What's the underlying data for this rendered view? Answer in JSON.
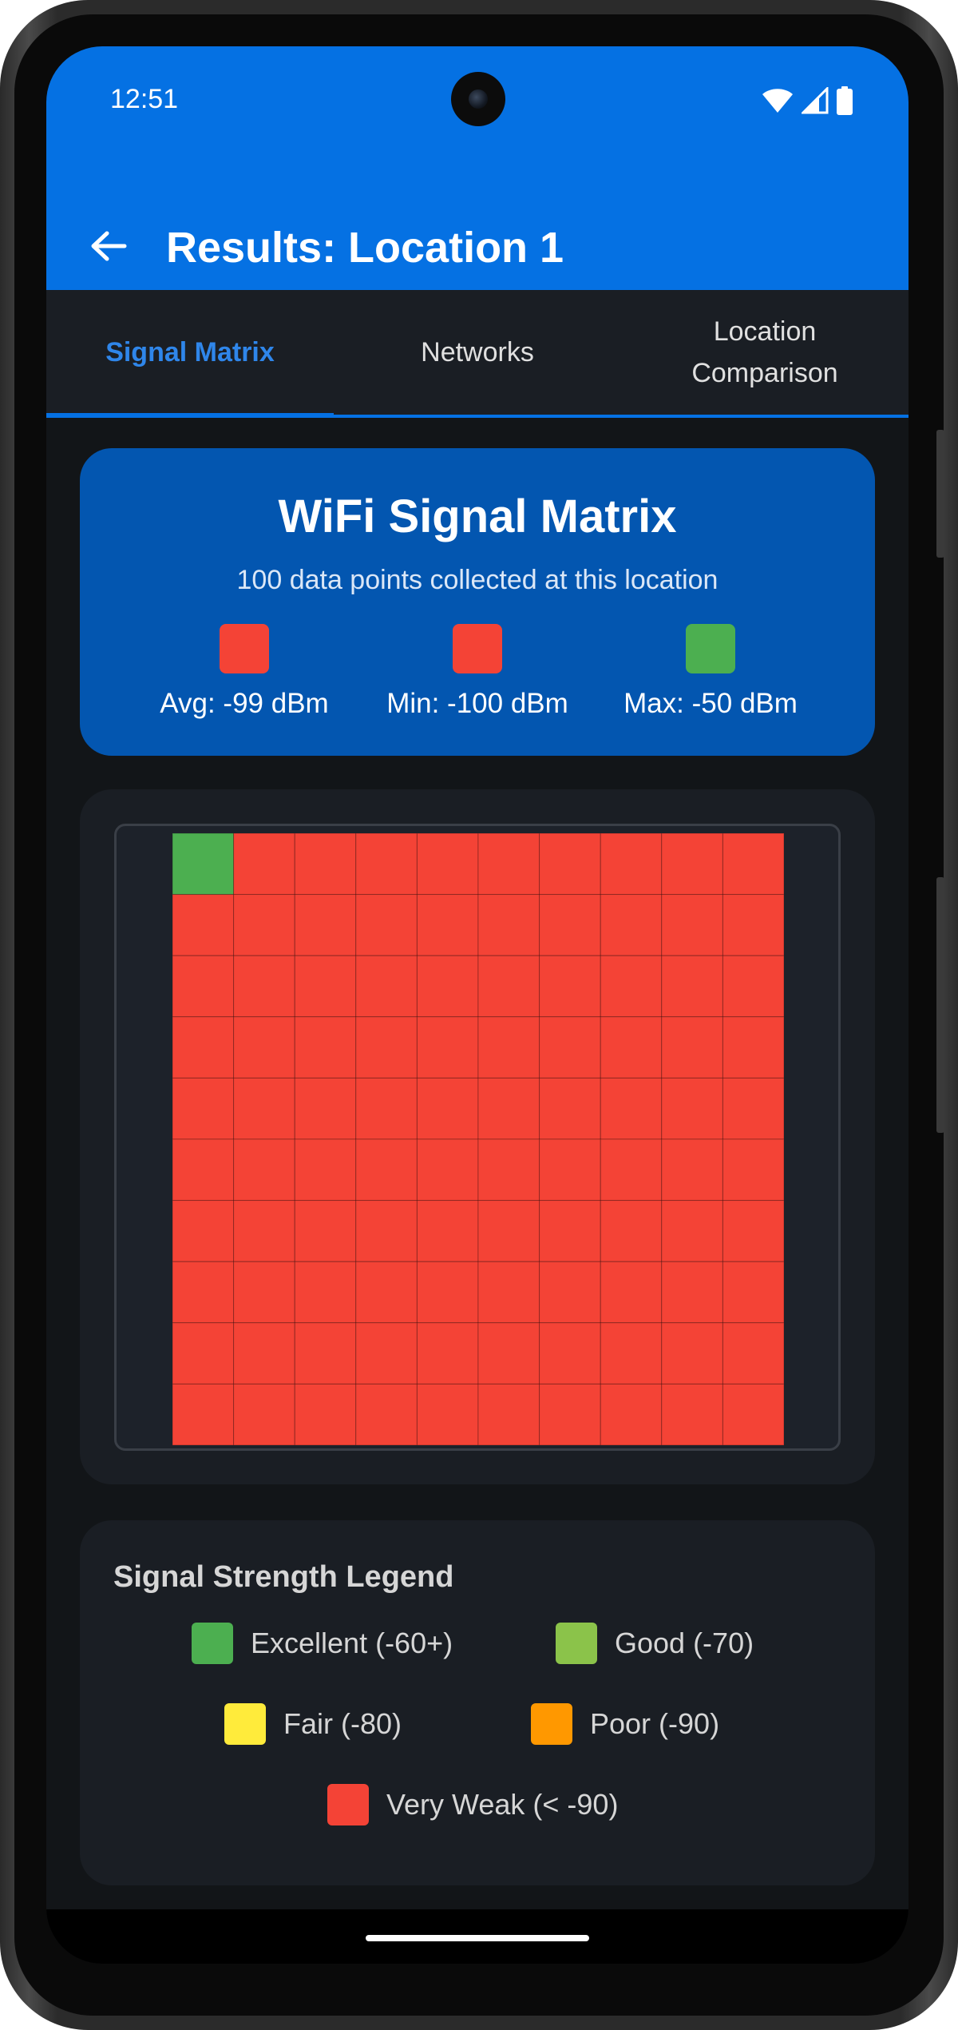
{
  "status_bar": {
    "time": "12:51",
    "icons": [
      "wifi-icon",
      "cell-signal-icon",
      "battery-icon"
    ]
  },
  "app_bar": {
    "title": "Results: Location 1",
    "back_icon": "arrow-back-icon",
    "background": "#0571e3"
  },
  "tabs": [
    {
      "label": "Signal Matrix",
      "active": true
    },
    {
      "label": "Networks",
      "active": false
    },
    {
      "label": "Location Comparison",
      "active": false
    }
  ],
  "summary": {
    "title": "WiFi Signal Matrix",
    "subtitle": "100 data points collected at this location",
    "stats": [
      {
        "label": "Avg: -99 dBm",
        "color": "#f44336"
      },
      {
        "label": "Min: -100 dBm",
        "color": "#f44336"
      },
      {
        "label": "Max: -50 dBm",
        "color": "#4caf50"
      }
    ]
  },
  "matrix": {
    "rows": 10,
    "cols": 10,
    "cells": [
      "excellent",
      "very_weak",
      "very_weak",
      "very_weak",
      "very_weak",
      "very_weak",
      "very_weak",
      "very_weak",
      "very_weak",
      "very_weak",
      "very_weak",
      "very_weak",
      "very_weak",
      "very_weak",
      "very_weak",
      "very_weak",
      "very_weak",
      "very_weak",
      "very_weak",
      "very_weak",
      "very_weak",
      "very_weak",
      "very_weak",
      "very_weak",
      "very_weak",
      "very_weak",
      "very_weak",
      "very_weak",
      "very_weak",
      "very_weak",
      "very_weak",
      "very_weak",
      "very_weak",
      "very_weak",
      "very_weak",
      "very_weak",
      "very_weak",
      "very_weak",
      "very_weak",
      "very_weak",
      "very_weak",
      "very_weak",
      "very_weak",
      "very_weak",
      "very_weak",
      "very_weak",
      "very_weak",
      "very_weak",
      "very_weak",
      "very_weak",
      "very_weak",
      "very_weak",
      "very_weak",
      "very_weak",
      "very_weak",
      "very_weak",
      "very_weak",
      "very_weak",
      "very_weak",
      "very_weak",
      "very_weak",
      "very_weak",
      "very_weak",
      "very_weak",
      "very_weak",
      "very_weak",
      "very_weak",
      "very_weak",
      "very_weak",
      "very_weak",
      "very_weak",
      "very_weak",
      "very_weak",
      "very_weak",
      "very_weak",
      "very_weak",
      "very_weak",
      "very_weak",
      "very_weak",
      "very_weak",
      "very_weak",
      "very_weak",
      "very_weak",
      "very_weak",
      "very_weak",
      "very_weak",
      "very_weak",
      "very_weak",
      "very_weak",
      "very_weak",
      "very_weak",
      "very_weak",
      "very_weak",
      "very_weak",
      "very_weak",
      "very_weak",
      "very_weak",
      "very_weak",
      "very_weak",
      "very_weak"
    ]
  },
  "legend": {
    "title": "Signal Strength Legend",
    "items": [
      {
        "key": "excellent",
        "label": "Excellent (-60+)",
        "color": "#4caf50"
      },
      {
        "key": "good",
        "label": "Good (-70)",
        "color": "#8bc34a"
      },
      {
        "key": "fair",
        "label": "Fair (-80)",
        "color": "#ffeb3b"
      },
      {
        "key": "poor",
        "label": "Poor (-90)",
        "color": "#ff9800"
      },
      {
        "key": "very_weak",
        "label": "Very Weak (< -90)",
        "color": "#f44336"
      }
    ]
  }
}
